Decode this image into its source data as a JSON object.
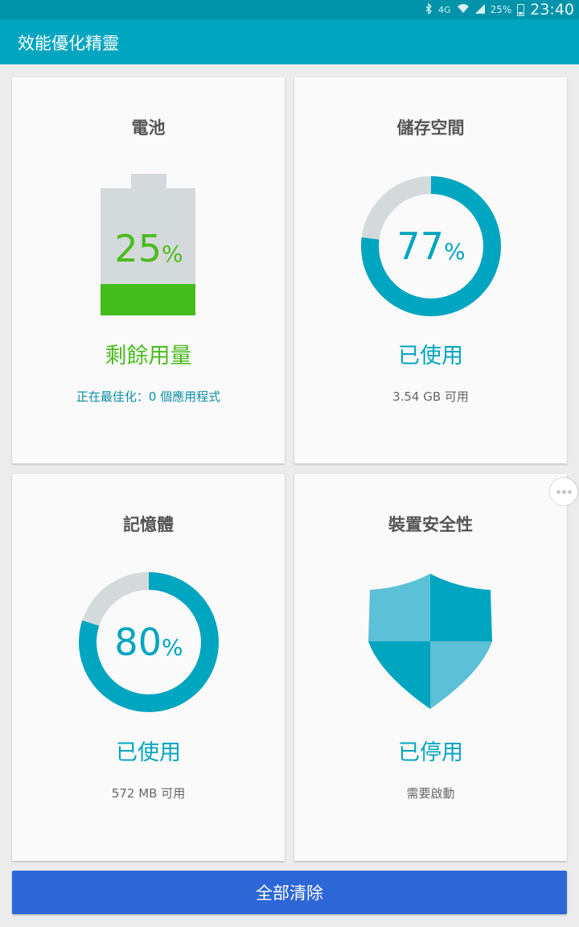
{
  "status_bar": {
    "network": "4G",
    "battery": "25%",
    "time": "23:40",
    "icons": [
      "bluetooth-icon",
      "wifi-icon",
      "signal-icon",
      "battery-icon"
    ]
  },
  "app": {
    "title": "效能優化精靈"
  },
  "battery_card": {
    "title": "電池",
    "percent": "25",
    "percent_sign": "%",
    "level": 0.25,
    "status": "剩餘用量",
    "detail": "正在最佳化：0 個應用程式",
    "color": "#44bd1c"
  },
  "storage_card": {
    "title": "儲存空間",
    "percent": "77",
    "percent_sign": "%",
    "used_fraction": 0.77,
    "status": "已使用",
    "detail": "3.54 GB 可用"
  },
  "memory_card": {
    "title": "記憶體",
    "percent": "80",
    "percent_sign": "%",
    "used_fraction": 0.8,
    "status": "已使用",
    "detail": "572 MB 可用"
  },
  "security_card": {
    "title": "裝置安全性",
    "status": "已停用",
    "detail": "需要啟動",
    "icon": "shield-icon"
  },
  "actions": {
    "clear_all": "全部清除"
  },
  "colors": {
    "accent": "#00a5c0",
    "ring_track": "#d4d9db",
    "button": "#2d67d7"
  }
}
